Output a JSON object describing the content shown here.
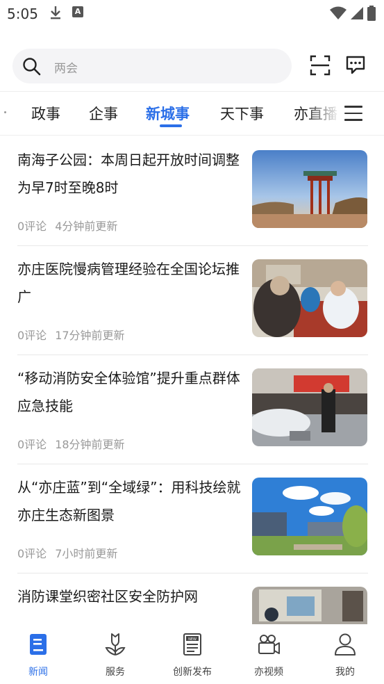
{
  "status_bar": {
    "time": "5:05",
    "icons": [
      "download-icon",
      "text-icon",
      "wifi-icon",
      "signal-icon",
      "battery-icon"
    ]
  },
  "search": {
    "placeholder": "两会",
    "icons": [
      "search-icon",
      "scan-icon",
      "message-icon"
    ]
  },
  "tabs": {
    "items": [
      "政事",
      "企事",
      "新城事",
      "天下事",
      "亦直播"
    ],
    "active": "新城事",
    "accent_color": "#2b6fe8"
  },
  "news": [
    {
      "title": "南海子公园：本周日起开放时间调整为早7时至晚8时",
      "comments": "0评论",
      "time": "4分钟前更新"
    },
    {
      "title": "亦庄医院慢病管理经验在全国论坛推广",
      "comments": "0评论",
      "time": "17分钟前更新"
    },
    {
      "title": "“移动消防安全体验馆”提升重点群体应急技能",
      "comments": "0评论",
      "time": "18分钟前更新"
    },
    {
      "title": "从“亦庄蓝”到“全域绿”：用科技绘就亦庄生态新图景",
      "comments": "0评论",
      "time": "7小时前更新"
    },
    {
      "title": "消防课堂织密社区安全防护网",
      "comments": "",
      "time": ""
    }
  ],
  "bottom_nav": [
    {
      "label": "新闻",
      "icon": "news-icon",
      "active": true
    },
    {
      "label": "服务",
      "icon": "service-icon",
      "active": false
    },
    {
      "label": "创新发布",
      "icon": "publish-icon",
      "active": false
    },
    {
      "label": "亦视频",
      "icon": "video-icon",
      "active": false
    },
    {
      "label": "我的",
      "icon": "profile-icon",
      "active": false
    }
  ]
}
